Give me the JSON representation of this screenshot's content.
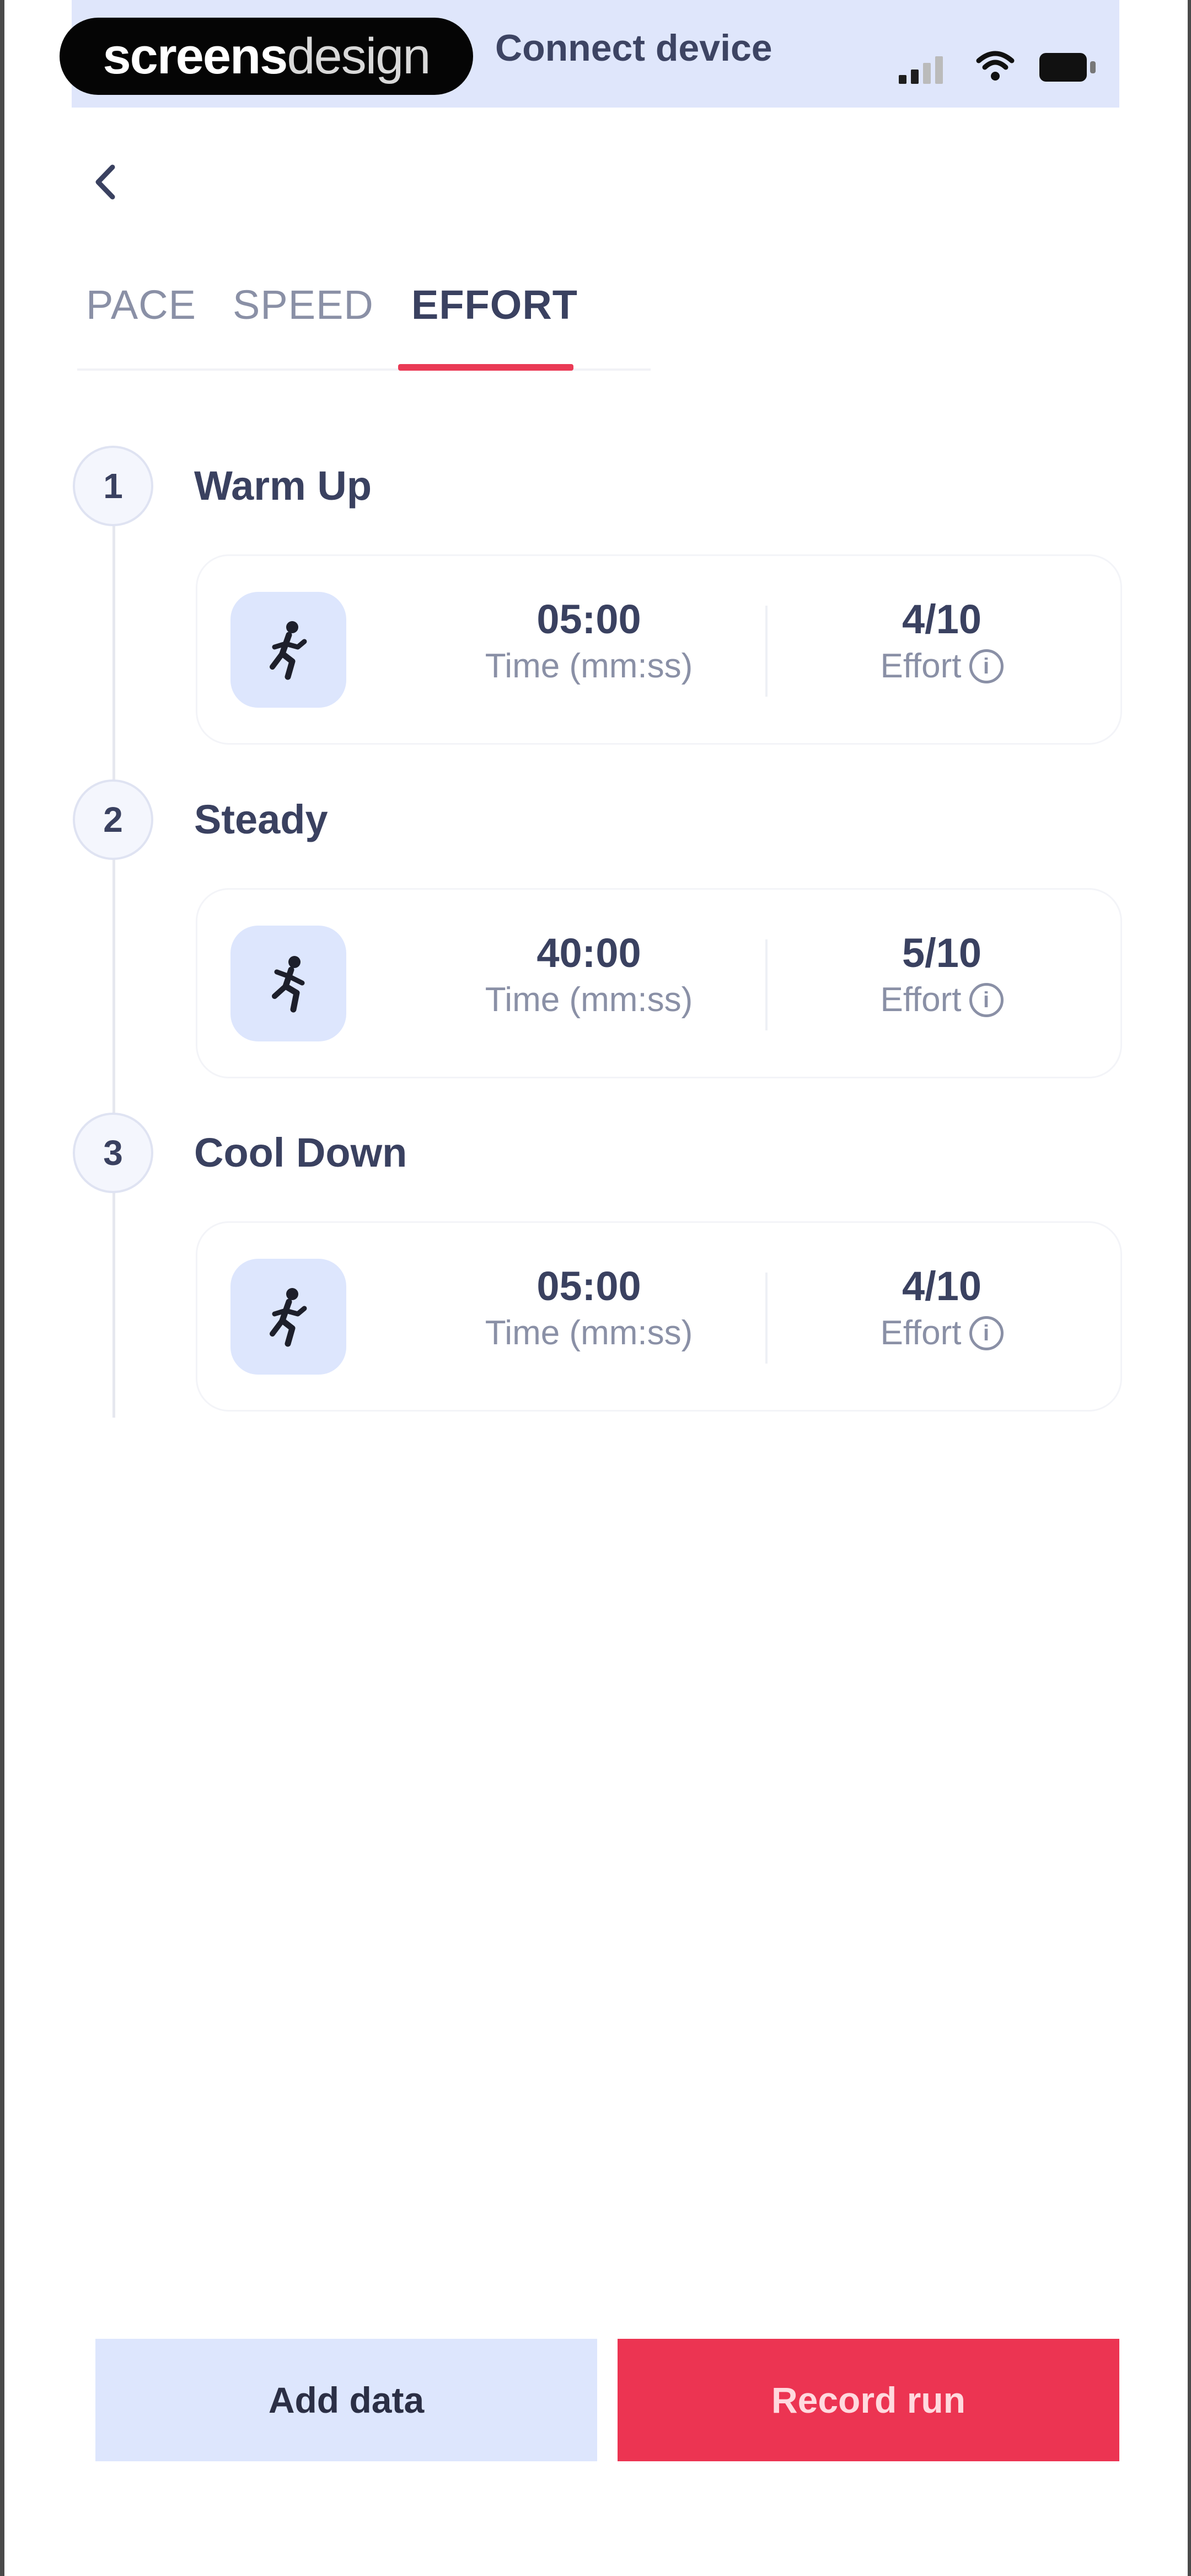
{
  "status_bar": {
    "brand_bold": "screens",
    "brand_light": "design",
    "title": "Connect device"
  },
  "tabs": [
    {
      "label": "PACE",
      "active": false
    },
    {
      "label": "SPEED",
      "active": false
    },
    {
      "label": "EFFORT",
      "active": true
    }
  ],
  "steps": [
    {
      "number": "1",
      "title": "Warm Up",
      "time_value": "05:00",
      "time_label": "Time (mm:ss)",
      "effort_value": "4/10",
      "effort_label": "Effort"
    },
    {
      "number": "2",
      "title": "Steady",
      "time_value": "40:00",
      "time_label": "Time (mm:ss)",
      "effort_value": "5/10",
      "effort_label": "Effort"
    },
    {
      "number": "3",
      "title": "Cool Down",
      "time_value": "05:00",
      "time_label": "Time (mm:ss)",
      "effort_value": "4/10",
      "effort_label": "Effort"
    }
  ],
  "buttons": {
    "add_data": "Add data",
    "record_run": "Record run"
  },
  "icons": {
    "back": "chevron-left-icon",
    "run": "running-person-icon",
    "info": "info-icon",
    "signal": "cellular-signal-icon",
    "wifi": "wifi-icon",
    "battery": "battery-icon"
  },
  "colors": {
    "accent": "#ea3a55",
    "record_button": "#ec3452",
    "banner": "#dfe6fb",
    "tile": "#dde6fd",
    "text": "#3a4160",
    "muted": "#8a90a6"
  }
}
